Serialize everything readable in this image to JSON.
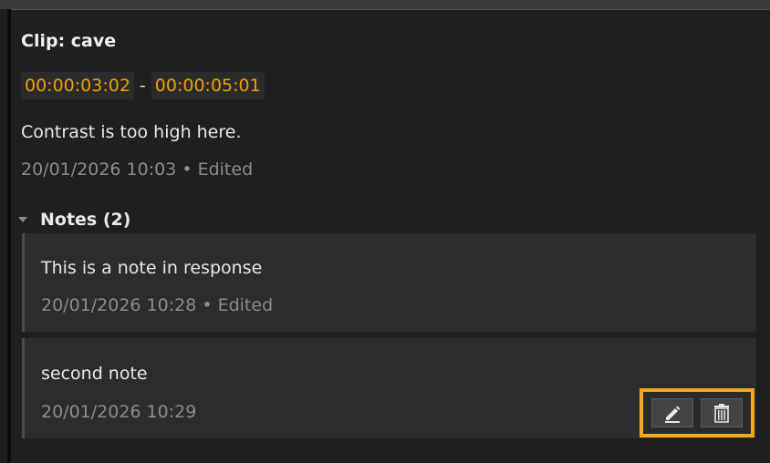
{
  "clip": {
    "title": "Clip: cave",
    "timecode_in": "00:00:03:02",
    "timecode_separator": "-",
    "timecode_out": "00:00:05:01",
    "comment": "Contrast is too high here.",
    "meta": "20/01/2026 10:03 • Edited"
  },
  "notes": {
    "header": "Notes (2)",
    "items": [
      {
        "text": "This is a note in response",
        "meta": "20/01/2026 10:28 • Edited"
      },
      {
        "text": "second note",
        "meta": "20/01/2026 10:29"
      }
    ]
  },
  "icons": {
    "collapse": "caret-down-icon",
    "edit": "pencil-icon",
    "delete": "trash-icon"
  },
  "colors": {
    "timecode": "#f0a000",
    "highlight": "#f2aa1c"
  }
}
